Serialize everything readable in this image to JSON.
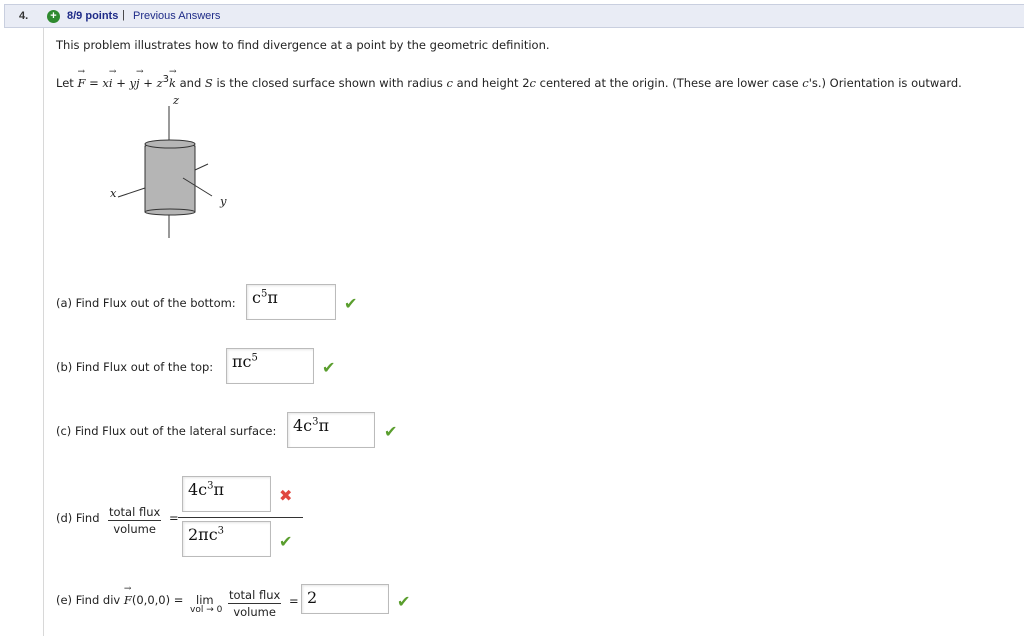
{
  "header": {
    "question_number": "4.",
    "points": "8/9 points",
    "separator": "|",
    "previous_answers": "Previous Answers"
  },
  "problem": {
    "intro": "This problem illustrates how to find divergence at a point by the geometric definition.",
    "let": "Let",
    "F": "F",
    "eq": " = ",
    "x": "x",
    "i": "i",
    "plus1": " + ",
    "y": "y",
    "j": "j",
    "plus2": " + ",
    "z3": "z",
    "exp3": "3",
    "k": "k",
    "and": " and ",
    "S": "S",
    "desc1": " is the closed surface shown with radius ",
    "c1": "c",
    "desc2": " and height 2",
    "c2": "c",
    "desc3": " centered at the origin. (These are lower case ",
    "c3": "c",
    "desc4": "'s.) Orientation is outward."
  },
  "figure": {
    "z_label": "z",
    "x_label": "x",
    "y_label": "y"
  },
  "parts": {
    "a": {
      "label": "(a) Find Flux out of the bottom:",
      "answer_base": "c",
      "answer_exp": "5",
      "answer_tail": "π",
      "status": "correct"
    },
    "b": {
      "label": "(b) Find Flux out of the top:",
      "answer_base": "πc",
      "answer_exp": "5",
      "answer_tail": "",
      "status": "correct"
    },
    "c": {
      "label": "(c) Find Flux out of the lateral surface:",
      "answer_base": "4c",
      "answer_exp": "3",
      "answer_tail": "π",
      "status": "correct"
    },
    "d": {
      "label": "(d) Find",
      "frac_num": "total flux",
      "frac_den": "volume",
      "equals": "=",
      "num_answer_base": "4c",
      "num_answer_exp": "3",
      "num_answer_tail": "π",
      "num_status": "incorrect",
      "den_answer_base": "2πc",
      "den_answer_exp": "3",
      "den_answer_tail": "",
      "den_status": "correct"
    },
    "e": {
      "label": "(e) Find div",
      "F": "F",
      "point": "(0,0,0) = ",
      "lim": "lim",
      "lim_sub": "vol → 0",
      "frac_num": "total flux",
      "frac_den": "volume",
      "equals": "=",
      "answer": "2",
      "status": "correct"
    }
  },
  "icons": {
    "correct": "check-icon",
    "incorrect": "x-icon"
  },
  "colors": {
    "correct": "#5a9e2e",
    "incorrect": "#e0473f",
    "header_bg": "#e9ecf5",
    "link": "#1e2b88"
  }
}
